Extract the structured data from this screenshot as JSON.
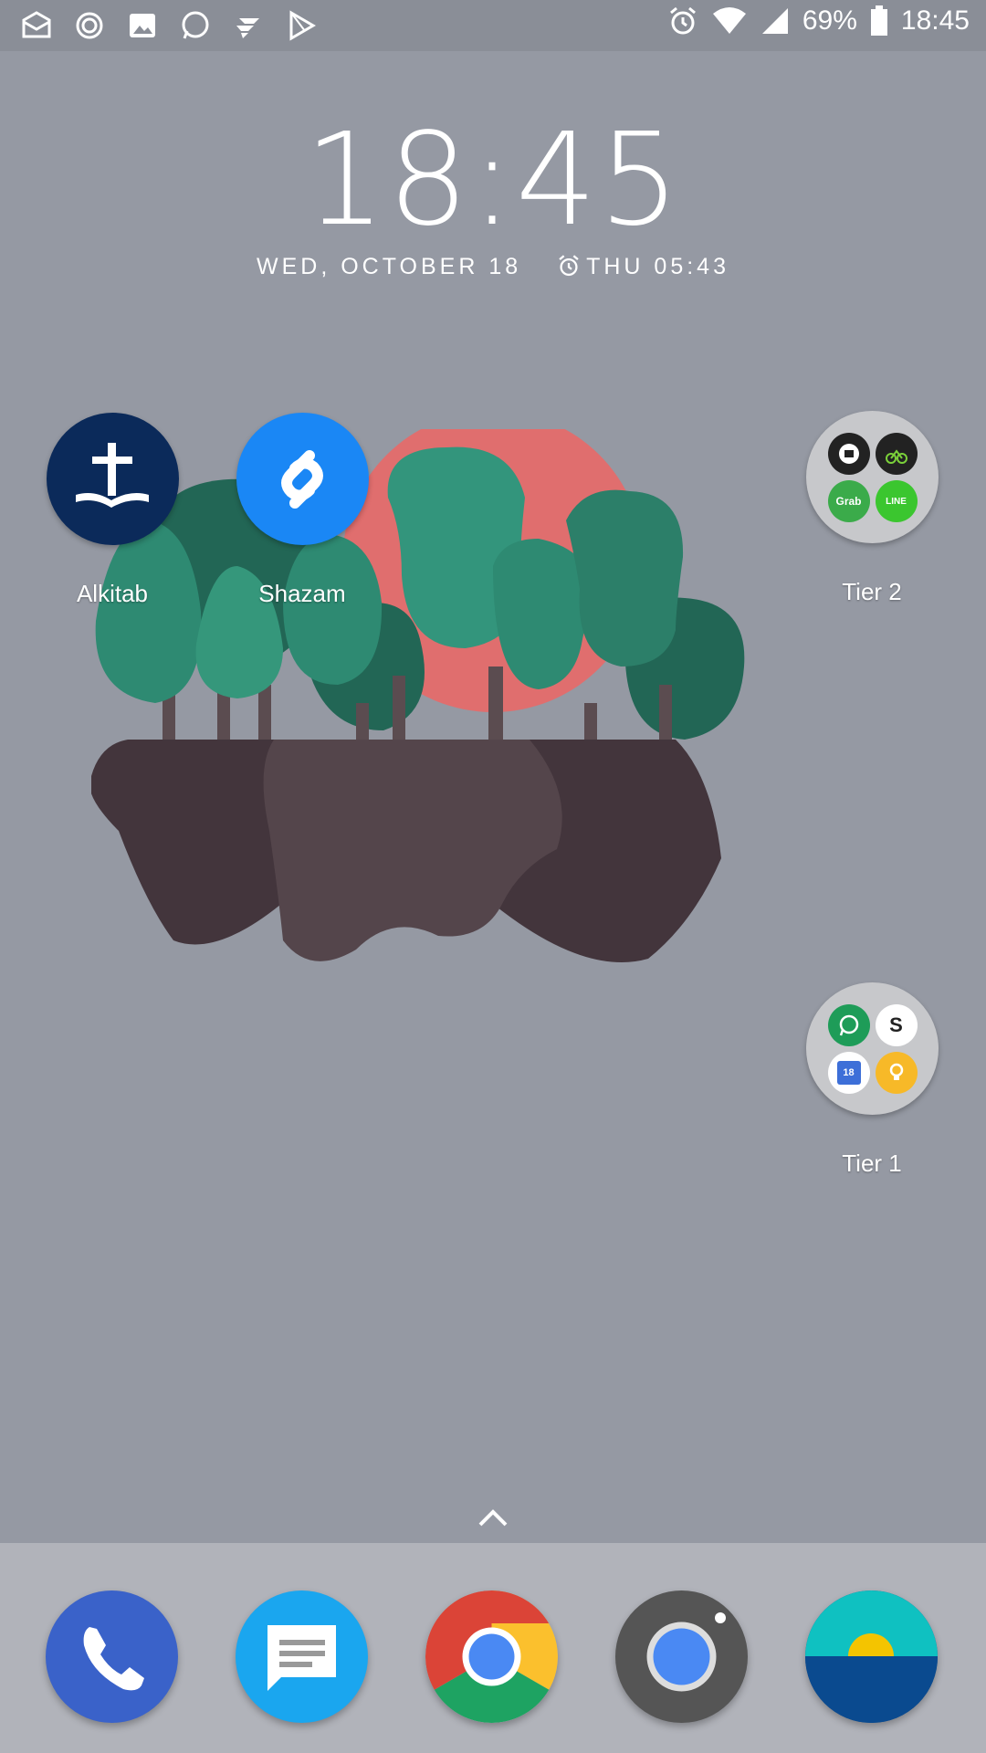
{
  "status_bar": {
    "notification_icons": [
      "mail-icon",
      "sync-icon",
      "image-icon",
      "whatsapp-icon",
      "jira-icon",
      "play-store-icon"
    ],
    "battery": "69%",
    "time": "18:45"
  },
  "clock": {
    "time": "18:45",
    "date": "WED, OCTOBER 18",
    "alarm": "THU 05:43"
  },
  "home": {
    "apps": [
      {
        "label": "Alkitab",
        "icon": "cross-book-icon",
        "color": "#0b2a5a"
      },
      {
        "label": "Shazam",
        "icon": "shazam-icon",
        "color": "#1a87f5"
      }
    ],
    "folders": [
      {
        "label": "Tier 2",
        "apps": [
          "uber-icon",
          "gojek-icon",
          "grab-icon",
          "line-icon"
        ],
        "mini_labels": [
          "",
          "",
          "Grab",
          "LINE"
        ]
      },
      {
        "label": "Tier 1",
        "apps": [
          "whatsapp-icon",
          "slack-icon",
          "calendar-icon",
          "keep-icon"
        ],
        "mini_labels": [
          "",
          "S",
          "18",
          ""
        ]
      }
    ]
  },
  "dock": {
    "apps": [
      {
        "name": "phone-icon",
        "color": "#3a62c9"
      },
      {
        "name": "messages-icon",
        "color": "#1aa6ef"
      },
      {
        "name": "chrome-icon",
        "color": "#db4437"
      },
      {
        "name": "camera-icon",
        "color": "#555555"
      },
      {
        "name": "wallpapers-icon",
        "color": "#0a4a8f"
      }
    ]
  }
}
